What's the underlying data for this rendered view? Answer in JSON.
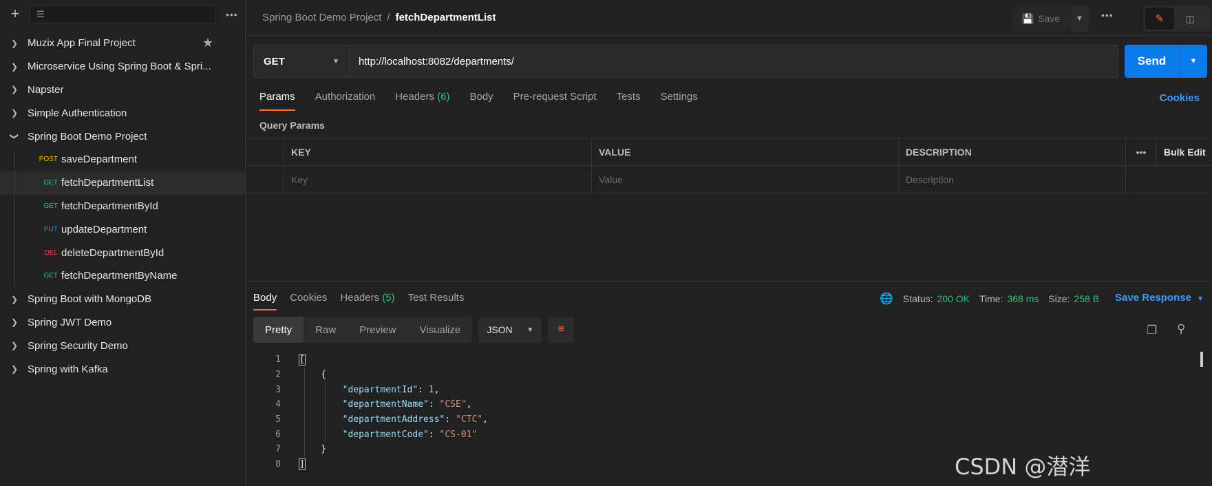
{
  "sidebar": {
    "collections": [
      {
        "label": "Muzix App Final Project",
        "expanded": false,
        "starred": true
      },
      {
        "label": "Microservice Using Spring Boot & Spri...",
        "expanded": false
      },
      {
        "label": "Napster",
        "expanded": false
      },
      {
        "label": "Simple Authentication",
        "expanded": false
      },
      {
        "label": "Spring Boot Demo Project",
        "expanded": true
      }
    ],
    "requests": [
      {
        "method": "POST",
        "label": "saveDepartment"
      },
      {
        "method": "GET",
        "label": "fetchDepartmentList",
        "active": true
      },
      {
        "method": "GET",
        "label": "fetchDepartmentById"
      },
      {
        "method": "PUT",
        "label": "updateDepartment"
      },
      {
        "method": "DEL",
        "label": "deleteDepartmentById"
      },
      {
        "method": "GET",
        "label": "fetchDepartmentByName"
      }
    ],
    "collections_after": [
      {
        "label": "Spring Boot with MongoDB"
      },
      {
        "label": "Spring JWT Demo"
      },
      {
        "label": "Spring Security Demo"
      },
      {
        "label": "Spring with Kafka"
      }
    ]
  },
  "header": {
    "breadcrumb_parent": "Spring Boot Demo Project",
    "breadcrumb_sep": "/",
    "breadcrumb_current": "fetchDepartmentList",
    "save_label": "Save"
  },
  "request": {
    "method": "GET",
    "url": "http://localhost:8082/departments/",
    "send_label": "Send",
    "tabs": [
      "Params",
      "Authorization",
      "Headers",
      "Body",
      "Pre-request Script",
      "Tests",
      "Settings"
    ],
    "headers_count": "(6)",
    "cookies_label": "Cookies",
    "query_params_title": "Query Params",
    "table": {
      "headers": [
        "KEY",
        "VALUE",
        "DESCRIPTION"
      ],
      "bulk_edit": "Bulk Edit",
      "placeholders": [
        "Key",
        "Value",
        "Description"
      ]
    }
  },
  "response": {
    "tabs": [
      "Body",
      "Cookies",
      "Headers",
      "Test Results"
    ],
    "headers_count": "(5)",
    "status_label": "Status:",
    "status_value": "200 OK",
    "time_label": "Time:",
    "time_value": "368 ms",
    "size_label": "Size:",
    "size_value": "258 B",
    "save_response_label": "Save Response",
    "formats": [
      "Pretty",
      "Raw",
      "Preview",
      "Visualize"
    ],
    "language": "JSON",
    "code_lines": [
      "1",
      "2",
      "3",
      "4",
      "5",
      "6",
      "7",
      "8"
    ],
    "json": {
      "departmentId_key": "\"departmentId\"",
      "departmentId_val": "1",
      "departmentName_key": "\"departmentName\"",
      "departmentName_val": "\"CSE\"",
      "departmentAddress_key": "\"departmentAddress\"",
      "departmentAddress_val": "\"CTC\"",
      "departmentCode_key": "\"departmentCode\"",
      "departmentCode_val": "\"CS-01\""
    }
  },
  "watermark": "CSDN @潜洋",
  "colors": {
    "accent": "#ff6c37",
    "send": "#097bed",
    "link": "#3e9bfb",
    "ok": "#2ec27e"
  }
}
